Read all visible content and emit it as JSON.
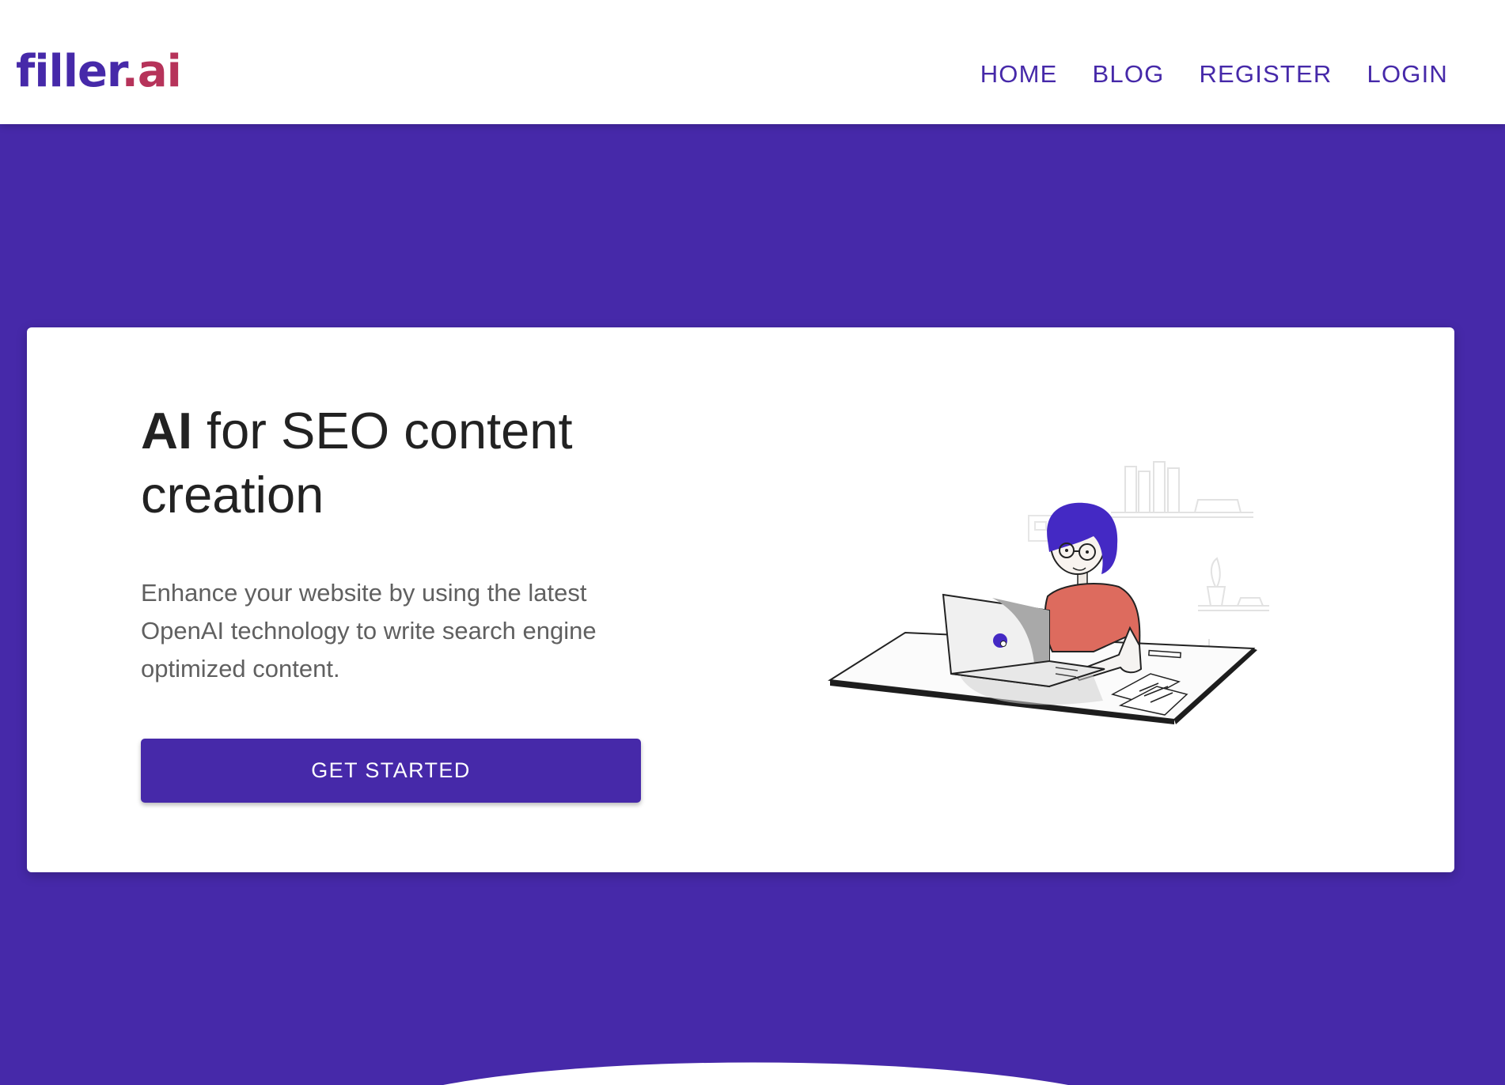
{
  "header": {
    "logo_main": "filler",
    "logo_tld": ".ai",
    "nav": [
      {
        "label": "HOME"
      },
      {
        "label": "BLOG"
      },
      {
        "label": "REGISTER"
      },
      {
        "label": "LOGIN"
      }
    ]
  },
  "hero": {
    "headline_strong": "AI",
    "headline_rest": " for SEO content creation",
    "description": "Enhance your website by using the latest OpenAI technology to write search engine optimized content.",
    "cta_label": "GET STARTED"
  },
  "colors": {
    "brand": "#4629a9",
    "logo_accent": "#b6335a",
    "illustration_shirt": "#dd6b5e"
  }
}
